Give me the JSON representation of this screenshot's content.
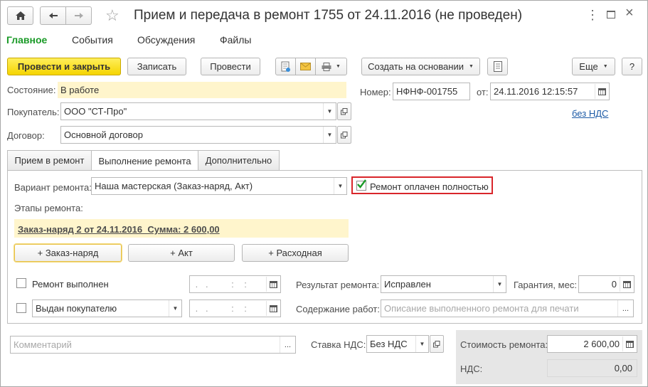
{
  "window": {
    "title": "Прием и передача в ремонт 1755 от 24.11.2016 (не проведен)"
  },
  "nav_tabs": [
    "Главное",
    "События",
    "Обсуждения",
    "Файлы"
  ],
  "toolbar": {
    "post_close": "Провести и закрыть",
    "save": "Записать",
    "post": "Провести",
    "create_based": "Создать на основании",
    "more": "Еще",
    "help": "?"
  },
  "header": {
    "state_label": "Состояние:",
    "state_value": "В работе",
    "number_label": "Номер:",
    "number_value": "НФНФ-001755",
    "date_label": "от:",
    "date_value": "24.11.2016 12:15:57",
    "vat_link": "без НДС",
    "buyer_label": "Покупатель:",
    "buyer_value": "ООО \"СТ-Про\"",
    "contract_label": "Договор:",
    "contract_value": "Основной договор"
  },
  "tabs": [
    "Прием в ремонт",
    "Выполнение ремонта",
    "Дополнительно"
  ],
  "repair": {
    "variant_label": "Вариант ремонта:",
    "variant_value": "Наша мастерская (Заказ-наряд, Акт)",
    "paid_label": "Ремонт оплачен полностью",
    "paid_checked": true,
    "stages_label": "Этапы ремонта:",
    "stage_link": "Заказ-наряд 2 от 24.11.2016  Сумма: 2 600,00",
    "add_order": "+ Заказ-наряд",
    "add_act": "+ Акт",
    "add_expense": "+ Расходная",
    "done_label": "Ремонт выполнен",
    "date_mask": " .   .         :    :  ",
    "result_label": "Результат ремонта:",
    "result_value": "Исправлен",
    "warranty_label": "Гарантия, мес:",
    "warranty_value": "0",
    "handover_value": "Выдан покупателю",
    "works_label": "Содержание работ:",
    "works_placeholder": "Описание выполненного ремонта для печати"
  },
  "footer": {
    "comment_placeholder": "Комментарий",
    "vat_rate_label": "Ставка НДС:",
    "vat_rate_value": "Без НДС",
    "cost_label": "Стоимость ремонта:",
    "cost_value": "2 600,00",
    "vat_label": "НДС:",
    "vat_value": "0,00"
  },
  "colors": {
    "accent_green": "#1a9a27",
    "primary_yellow": "#f5d400",
    "highlight_red": "#d9262b",
    "link_blue": "#1c5aa6",
    "stage_bg": "#fff5cc"
  }
}
